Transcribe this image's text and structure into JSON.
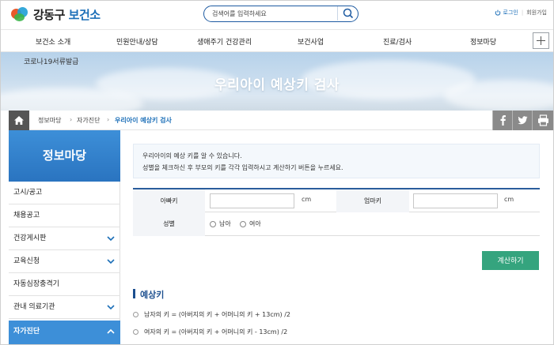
{
  "header": {
    "logo_city": "강동구",
    "logo_org": "보건소",
    "search_placeholder": "검색어를 입력하세요",
    "login": "로그인",
    "join": "회원가입"
  },
  "gnb": {
    "items": [
      "보건소 소개",
      "민원안내/상담",
      "생애주기 건강관리",
      "보건사업",
      "진료/검사",
      "정보마당"
    ]
  },
  "visual": {
    "covid_link": "코로나19서류발급",
    "title": "우리아이 예상키 검사"
  },
  "breadcrumb": {
    "items": [
      "정보마당",
      "자가진단",
      "우리아이 예상키 검사"
    ]
  },
  "sidebar": {
    "title": "정보마당",
    "items": [
      {
        "label": "고시/공고",
        "has_sub": false
      },
      {
        "label": "채용공고",
        "has_sub": false
      },
      {
        "label": "건강게시판",
        "has_sub": true
      },
      {
        "label": "교육신청",
        "has_sub": true
      },
      {
        "label": "자동심장충격기",
        "has_sub": false
      },
      {
        "label": "관내 의료기관",
        "has_sub": true
      },
      {
        "label": "자가진단",
        "has_sub": true,
        "active": true
      }
    ]
  },
  "content": {
    "info_lines": [
      "우리아이의 예상 키를 알 수 있습니다.",
      "성별을 체크하신 후 부모의 키를 각각 입력하시고 계산하기 버튼을 누르세요."
    ],
    "form": {
      "father_label": "아빠키",
      "father_value": "",
      "mother_label": "엄마키",
      "mother_value": "",
      "unit": "cm",
      "gender_label": "성별",
      "gender_options": [
        "남아",
        "여아"
      ]
    },
    "calc_button": "계산하기",
    "result_title": "예상키",
    "formulas": [
      "남자의 키 = (아버지의 키 + 어머니의 키 + 13cm) /2",
      "여자의 키 = (아버지의 키 + 어머니의 키 - 13cm) /2"
    ]
  },
  "colors": {
    "primary": "#1c6fb8",
    "sidebar_head": "#3d8fd8",
    "calc_button": "#35a47e",
    "table_top": "#2a5d9c"
  }
}
